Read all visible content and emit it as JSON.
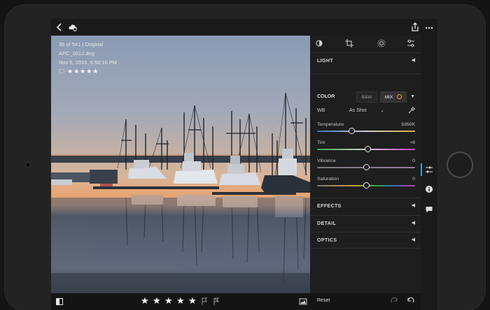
{
  "app": {
    "icons": [
      "back-arrow-icon",
      "cloud-sync-icon",
      "share-icon",
      "more-icon"
    ]
  },
  "photo_info": {
    "position": "35 of 541 | Original",
    "filename": "APC_0012.dng",
    "datetime": "Nov 5, 2016, 6:58:16 PM",
    "rating": "★★★★★"
  },
  "toolbar": {
    "stars": [
      "★",
      "★",
      "★",
      "★",
      "★"
    ],
    "rating_value": 5
  },
  "panel": {
    "tabs": [
      "presets-icon",
      "crop-icon",
      "selective-icon",
      "edit-icon"
    ],
    "sections": {
      "light": "LIGHT",
      "color": "COLOR",
      "effects": "EFFECTS",
      "detail": "DETAIL",
      "optics": "OPTICS"
    },
    "color": {
      "bw_label": "B&W",
      "mix_label": "MIX",
      "wb_label": "WB",
      "wb_value": "As Shot"
    },
    "sliders": [
      {
        "name": "Temperature",
        "value": "5350K",
        "position": 0.35
      },
      {
        "name": "Tint",
        "value": "+6",
        "position": 0.52
      },
      {
        "name": "Vibrance",
        "value": "0",
        "position": 0.5
      },
      {
        "name": "Saturation",
        "value": "0",
        "position": 0.5
      }
    ],
    "reset_label": "Reset"
  },
  "colors": {
    "accent": "#3aa0e8",
    "mix_ring": "#e4a23a",
    "panel_bg": "#1e1e1e"
  }
}
